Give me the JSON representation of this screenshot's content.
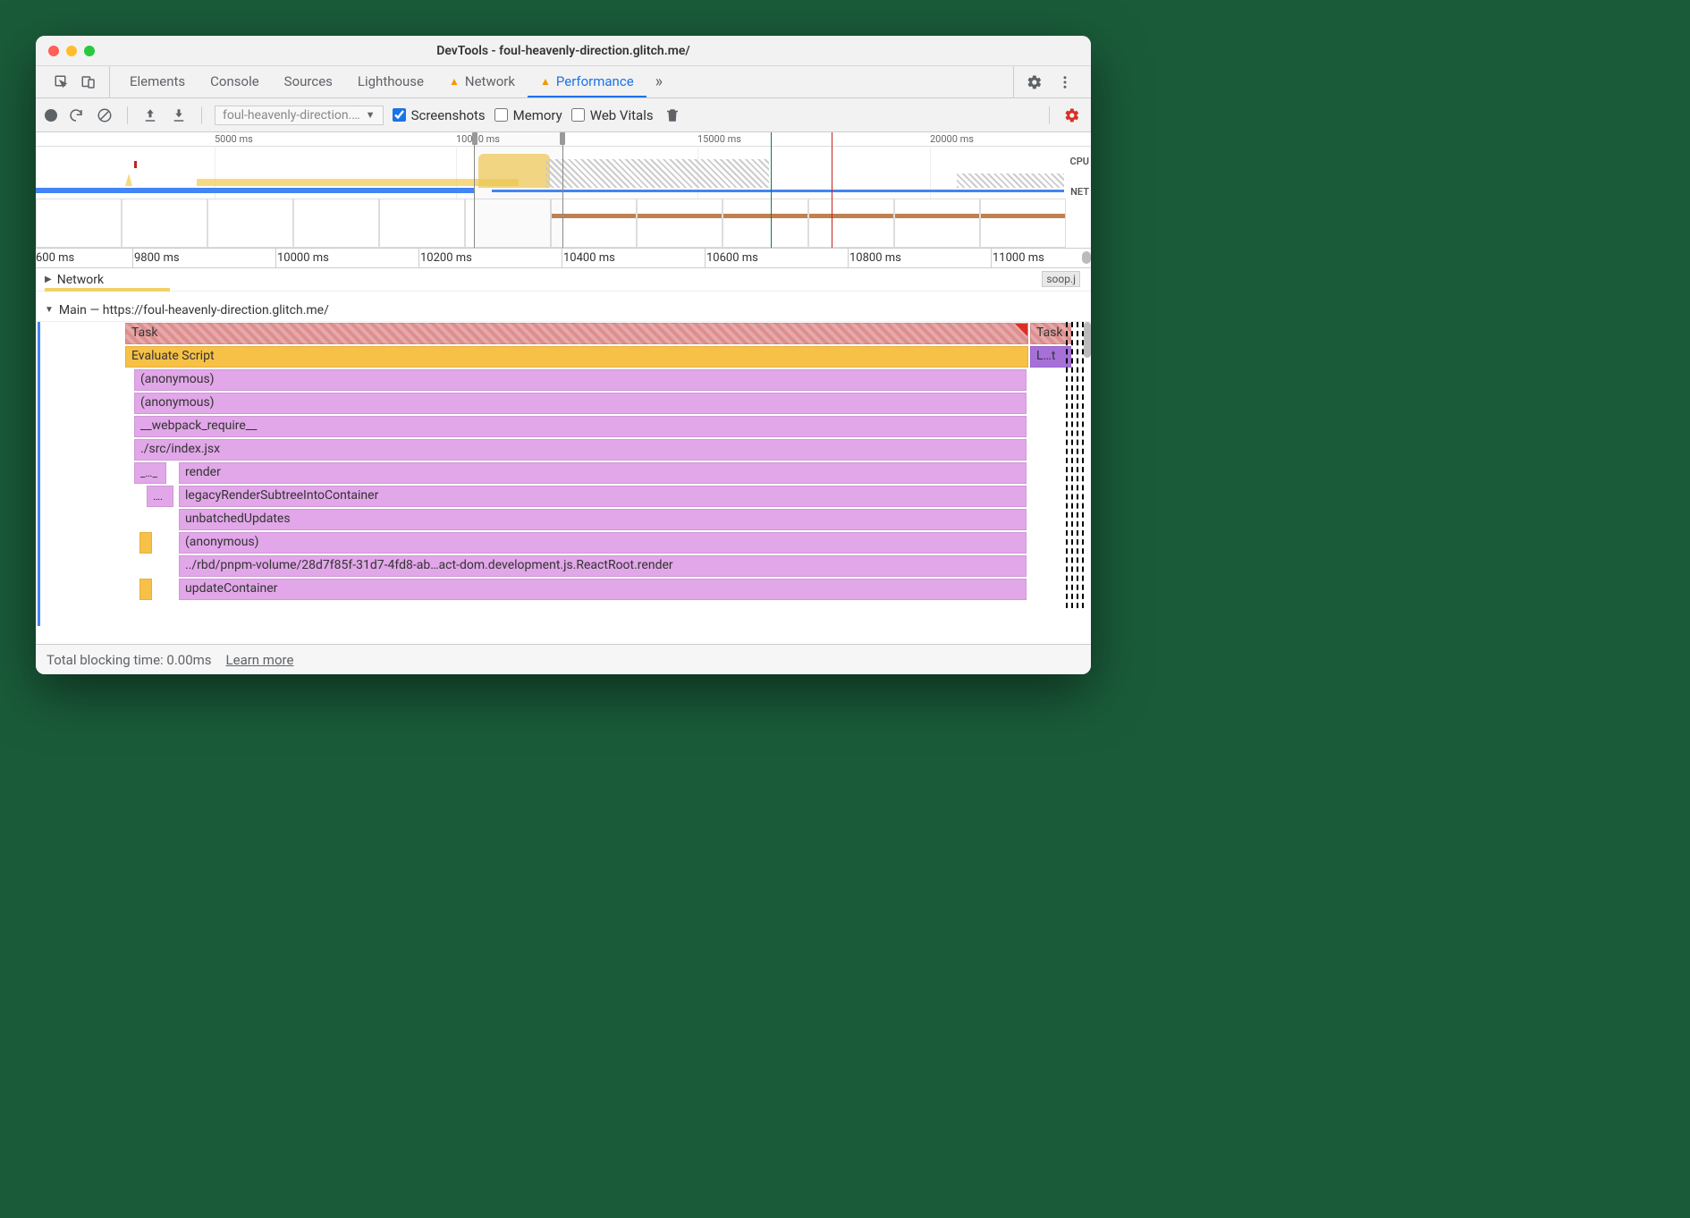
{
  "window_title": "DevTools - foul-heavenly-direction.glitch.me/",
  "tabs": {
    "elements": "Elements",
    "console": "Console",
    "sources": "Sources",
    "lighthouse": "Lighthouse",
    "network": "Network",
    "performance": "Performance",
    "more": "»"
  },
  "toolbar": {
    "profile_name": "foul-heavenly-direction.…",
    "screenshots": "Screenshots",
    "memory": "Memory",
    "web_vitals": "Web Vitals"
  },
  "overview": {
    "ticks": [
      "5000 ms",
      "10000 ms",
      "15000 ms",
      "20000 ms"
    ],
    "cpu_label": "CPU",
    "net_label": "NET"
  },
  "ruler": [
    "600 ms",
    "9800 ms",
    "10000 ms",
    "10200 ms",
    "10400 ms",
    "10600 ms",
    "10800 ms",
    "11000 ms"
  ],
  "tracks": {
    "network_header": "Network",
    "network_item": "soop.j",
    "main_header": "Main — https://foul-heavenly-direction.glitch.me/"
  },
  "flame": {
    "task": "Task",
    "task2": "Task",
    "eval": "Evaluate Script",
    "layout_short": "L…t",
    "rows": [
      "(anonymous)",
      "(anonymous)",
      "__webpack_require__",
      "./src/index.jsx",
      "render",
      "legacyRenderSubtreeIntoContainer",
      "unbatchedUpdates",
      "(anonymous)",
      "../rbd/pnpm-volume/28d7f85f-31d7-4fd8-ab…act-dom.development.js.ReactRoot.render",
      "updateContainer"
    ],
    "row4_pre": "_…_",
    "row5_pre": "…."
  },
  "footer": {
    "tbt": "Total blocking time: 0.00ms",
    "learn": "Learn more"
  }
}
